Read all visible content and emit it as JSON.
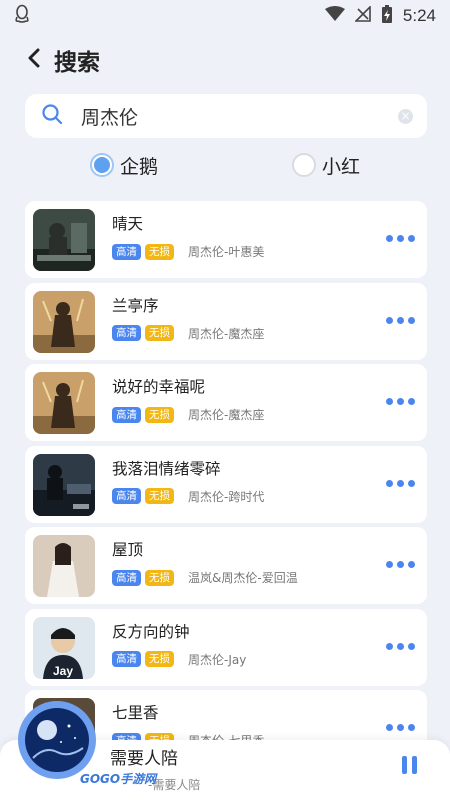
{
  "status_bar": {
    "time": "5:24"
  },
  "header": {
    "title": "搜索"
  },
  "search": {
    "query": "周杰伦"
  },
  "sources": [
    {
      "label": "企鹅",
      "selected": true
    },
    {
      "label": "小红",
      "selected": false
    }
  ],
  "songs": [
    {
      "title": "晴天",
      "quality": "高清",
      "lossless": "无损",
      "artist_album": "周杰伦-叶惠美"
    },
    {
      "title": "兰亭序",
      "quality": "高清",
      "lossless": "无损",
      "artist_album": "周杰伦-魔杰座"
    },
    {
      "title": "说好的幸福呢",
      "quality": "高清",
      "lossless": "无损",
      "artist_album": "周杰伦-魔杰座"
    },
    {
      "title": "我落泪情绪零碎",
      "quality": "高清",
      "lossless": "无损",
      "artist_album": "周杰伦-跨时代"
    },
    {
      "title": "屋顶",
      "quality": "高清",
      "lossless": "无损",
      "artist_album": "温岚&周杰伦-爱回温"
    },
    {
      "title": "反方向的钟",
      "quality": "高清",
      "lossless": "无损",
      "artist_album": "周杰伦-Jay"
    },
    {
      "title": "七里香",
      "quality": "高清",
      "lossless": "无损",
      "artist_album": "周杰伦-七里香"
    }
  ],
  "player": {
    "title": "需要人陪",
    "info": "-需要人陪",
    "watermark": "GOGO手游网"
  },
  "colors": {
    "accent": "#4b86ef",
    "lossless_tag": "#f2b714",
    "background": "#eef1f7"
  }
}
